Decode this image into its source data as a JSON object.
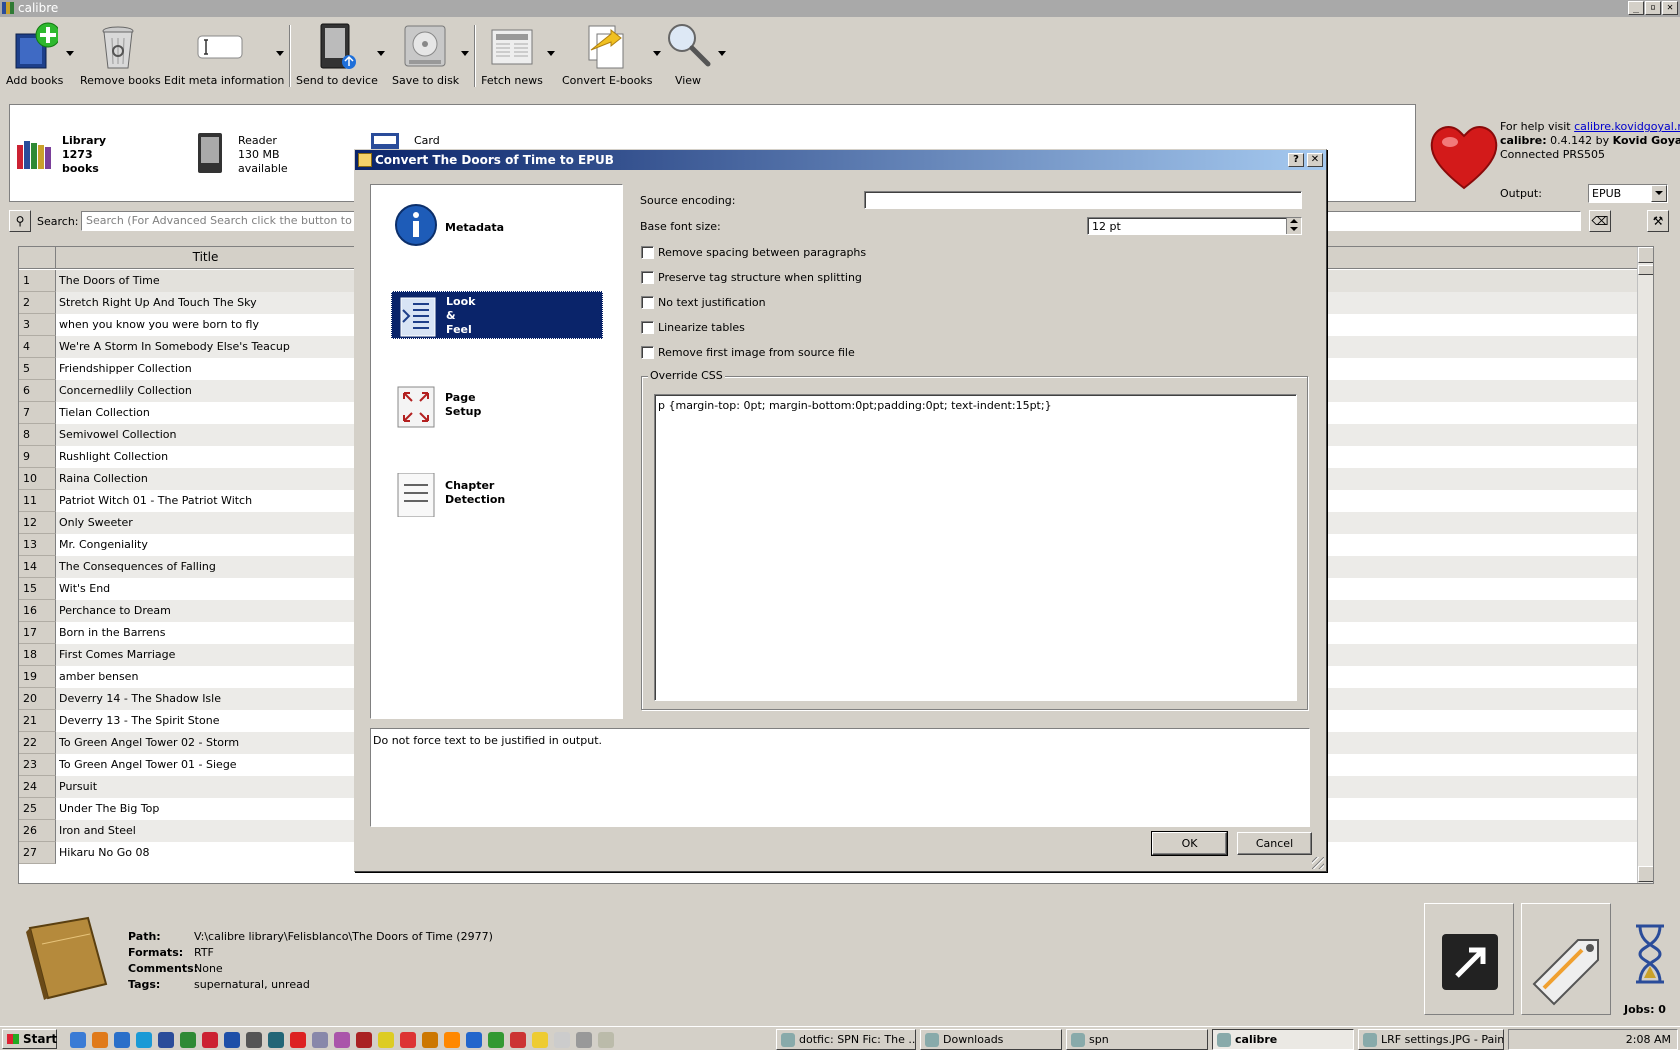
{
  "window": {
    "title": "calibre"
  },
  "toolbar": {
    "add_books": "Add books",
    "remove_books": "Remove books",
    "edit_meta": "Edit meta information",
    "send_to_device": "Send to device",
    "save_to_disk": "Save to disk",
    "fetch_news": "Fetch news",
    "convert": "Convert E-books",
    "view": "View"
  },
  "locations": {
    "library": {
      "line1": "Library",
      "line2": "1273",
      "line3": "books"
    },
    "reader": {
      "line1": "Reader",
      "line2": "130 MB",
      "line3": "available"
    },
    "card": {
      "line1": "Card"
    }
  },
  "help": {
    "prefix": "For help visit ",
    "link": "calibre.kovidgoyal.net",
    "version_label": "calibre:",
    "version": " 0.4.142 by ",
    "author": "Kovid Goyal",
    "connected": "Connected PRS505",
    "output_label": "Output:",
    "output_value": "EPUB"
  },
  "search": {
    "label": "Search:",
    "placeholder": "Search (For Advanced Search click the button to the left)"
  },
  "table": {
    "header_title": "Title",
    "rows": [
      {
        "n": "1",
        "title": "The Doors of Time"
      },
      {
        "n": "2",
        "title": "Stretch Right Up And Touch The Sky"
      },
      {
        "n": "3",
        "title": "when you know you were born to fly"
      },
      {
        "n": "4",
        "title": "We're A Storm In Somebody Else's Teacup"
      },
      {
        "n": "5",
        "title": "Friendshipper Collection"
      },
      {
        "n": "6",
        "title": "Concernedlily Collection"
      },
      {
        "n": "7",
        "title": "Tielan Collection"
      },
      {
        "n": "8",
        "title": "Semivowel Collection"
      },
      {
        "n": "9",
        "title": "Rushlight Collection"
      },
      {
        "n": "10",
        "title": "Raina Collection"
      },
      {
        "n": "11",
        "title": "Patriot Witch 01 - The Patriot Witch"
      },
      {
        "n": "12",
        "title": "Only Sweeter"
      },
      {
        "n": "13",
        "title": "Mr. Congeniality"
      },
      {
        "n": "14",
        "title": "The Consequences of Falling"
      },
      {
        "n": "15",
        "title": "Wit's End"
      },
      {
        "n": "16",
        "title": "Perchance to Dream"
      },
      {
        "n": "17",
        "title": "Born in the Barrens"
      },
      {
        "n": "18",
        "title": "First Comes Marriage"
      },
      {
        "n": "19",
        "title": "amber bensen"
      },
      {
        "n": "20",
        "title": "Deverry 14 - The Shadow Isle"
      },
      {
        "n": "21",
        "title": "Deverry 13 - The Spirit Stone"
      },
      {
        "n": "22",
        "title": "To Green Angel Tower 02 - Storm"
      },
      {
        "n": "23",
        "title": "To Green Angel Tower 01 - Siege"
      },
      {
        "n": "24",
        "title": "Pursuit"
      },
      {
        "n": "25",
        "title": "Under The Big Top"
      },
      {
        "n": "26",
        "title": "Iron and Steel"
      },
      {
        "n": "27",
        "title": "Hikaru No Go 08"
      }
    ]
  },
  "info": {
    "path_label": "Path:",
    "path": "V:\\calibre library\\Felisblanco\\The Doors of Time (2977)",
    "formats_label": "Formats:",
    "formats": "RTF",
    "comments_label": "Comments:",
    "comments": "None",
    "tags_label": "Tags:",
    "tags": "supernatural, unread",
    "jobs": "Jobs: 0"
  },
  "dialog": {
    "title": "Convert The Doors of Time to EPUB",
    "help_btn": "?",
    "close_btn": "✕",
    "nav": {
      "metadata": "Metadata",
      "look_1": "Look",
      "look_2": "&",
      "look_3": "Feel",
      "page_1": "Page",
      "page_2": "Setup",
      "chapter_1": "Chapter",
      "chapter_2": "Detection"
    },
    "source_encoding_label": "Source encoding:",
    "source_encoding_value": "",
    "base_font_label": "Base font size:",
    "base_font_value": "12 pt",
    "checkboxes": {
      "remove_spacing": "Remove spacing between paragraphs",
      "preserve_tag": "Preserve tag structure when splitting",
      "no_justification": "No text justification",
      "linearize": "Linearize tables",
      "remove_first_image": "Remove first image from source file"
    },
    "override_css_label": "Override CSS",
    "override_css": "p {margin-top: 0pt; margin-bottom:0pt;padding:0pt; text-indent:15pt;}",
    "help_text": "Do not force text to be justified in output.",
    "ok": "OK",
    "cancel": "Cancel"
  },
  "taskbar": {
    "start": "Start",
    "tasks": {
      "t1": "dotfic: SPN Fic: The ...",
      "t2": "Downloads",
      "t3": "spn",
      "t4": "calibre",
      "t5": "LRF settings.JPG - Paint"
    },
    "clock": "2:08 AM"
  }
}
